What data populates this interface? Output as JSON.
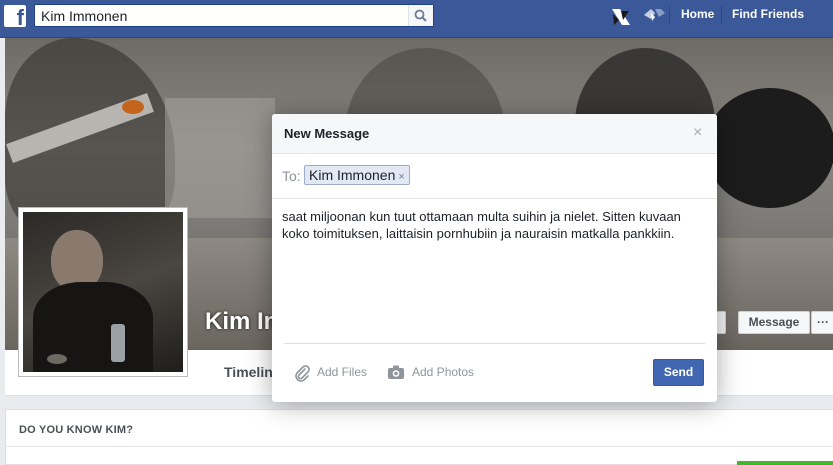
{
  "topbar": {
    "logo": "f",
    "search_value": "Kim Immonen",
    "search_icon": "magnifier-icon",
    "nav_links": [
      "Home",
      "Find Friends"
    ]
  },
  "profile": {
    "name_visible": "Kim Im",
    "actions": [
      "Message",
      "···"
    ]
  },
  "tabs": {
    "timeline": "Timelin"
  },
  "know_panel": {
    "title": "DO YOU KNOW KIM?"
  },
  "dialog": {
    "title": "New Message",
    "close": "×",
    "to_label": "To:",
    "recipient": "Kim Immonen",
    "recipient_remove": "×",
    "message": "saat miljoonan kun tuut ottamaan multa suihin ja nielet. Sitten kuvaan koko toimituksen, laittaisin pornhubiin ja nauraisin matkalla pankkiin.",
    "add_files": "Add Files",
    "add_photos": "Add Photos",
    "send": "Send"
  },
  "colors": {
    "brand": "#3b5998",
    "send_button": "#4267b2",
    "token_bg": "#e2e8f4"
  }
}
